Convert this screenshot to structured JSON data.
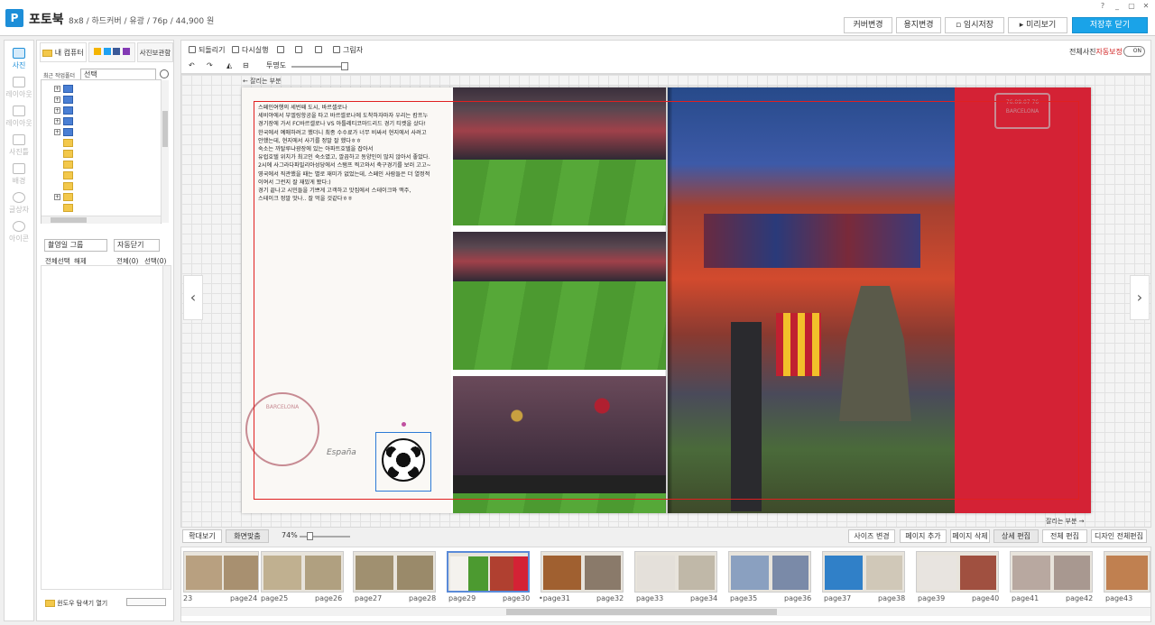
{
  "app": {
    "logo": "P",
    "title": "포토북",
    "product_info": "8x8 / 하드커버 / 유광 / 76p / 44,900 원"
  },
  "window_controls": [
    "?",
    "_",
    "▢",
    "✕"
  ],
  "top_buttons": {
    "cover_change": "커버변경",
    "paper_change": "용지변경",
    "temp_save": "임시저장",
    "preview": "미리보기",
    "save_close": "저장후 닫기"
  },
  "left_tools": [
    "사진",
    "레이아웃",
    "레이아웃",
    "사진틀",
    "배경",
    "글상자",
    "아이콘"
  ],
  "left_panel": {
    "tab_my_computer": "내 컴퓨터",
    "tab_photo_storage": "사진보관함",
    "recent_folder_label": "최근 작업폴더",
    "recent_folder_value": "선택",
    "group_select": "촬영일 그룹",
    "auto_close": "자동닫기",
    "select_all": "전체선택",
    "deselect": "해제",
    "count_all": "전체(0)",
    "count_selected": "선택(0)",
    "open_explorer": "윈도우 탐색기 열기"
  },
  "toolbar": {
    "undo": "되돌리기",
    "redo": "다시실행",
    "shadow": "그림자",
    "transparency": "투명도",
    "auto_correct_label": "전체사진",
    "auto_correct_value": "자동보정",
    "toggle": "ON"
  },
  "canvas": {
    "cut_label_top": "잘리는 부분",
    "cut_label_bottom": "잘리는 부분",
    "prev_arrow": "‹",
    "next_arrow": "›",
    "note_text": "스페인여행의 세번째 도시, 바르셀로나\n세비야에서 부엘링항공을 타고 바르셀로나에 도착하자마자 우리는 캄프누\n경기장에 가서 FC바르셀로나 VS 아틀레티코마드리드 경기 티켓을 샀다!\n한국에서 예매하려고 했더니 최종 수수료가 너무 비싸서 현지에서 사려고\n안했는데, 현지에서 사기를 정말 잘 했다ㅎㅎ\n숙소는 까탈루냐광장에 있는 아파트호텔을 잡아서\n유럽호텔 위치가 최고인 숙소였고, 깔끔하고 동양인이 많지 않아서 좋았다.\n2시에 사그라다파밀리아성당에서 스탬프 찍고와서 축구경기를 보러 고고~\n영국에서 직관했을 때는 별로 재미가 없었는데, 스페인 사람들은 더 열정적\n이여서 그런지 잘 재밌게 봤다:)\n경기 끝나고 시민들을 기쁘게 고객하고 맛집에서 스테이크와 맥주,\n스테이크 정말 맛나.. 잘 먹을 것같다ㅎㅎ",
    "signature": "España",
    "stamp_text": "BARCELONA",
    "stamp2_text": "76.09.07 76 BARCELONA"
  },
  "bottom_bar": {
    "expand": "확대보기",
    "fit": "화면맞춤",
    "zoom_percent": "74%",
    "size_change": "사이즈 변경",
    "add_page": "페이지 추가",
    "delete_page": "페이지 삭제",
    "detail_edit": "상세 편집",
    "full_edit": "전체 편집",
    "design_edit": "디자인 전체편집"
  },
  "thumbnails": [
    {
      "left": "23",
      "right": "page24"
    },
    {
      "left": "page25",
      "right": "page26"
    },
    {
      "left": "page27",
      "right": "page28"
    },
    {
      "left": "page29",
      "right": "page30"
    },
    {
      "left": "•page31",
      "right": "page32"
    },
    {
      "left": "page33",
      "right": "page34"
    },
    {
      "left": "page35",
      "right": "page36"
    },
    {
      "left": "page37",
      "right": "page38"
    },
    {
      "left": "page39",
      "right": "page40"
    },
    {
      "left": "page41",
      "right": "page42"
    },
    {
      "left": "page43",
      "right": ""
    }
  ]
}
